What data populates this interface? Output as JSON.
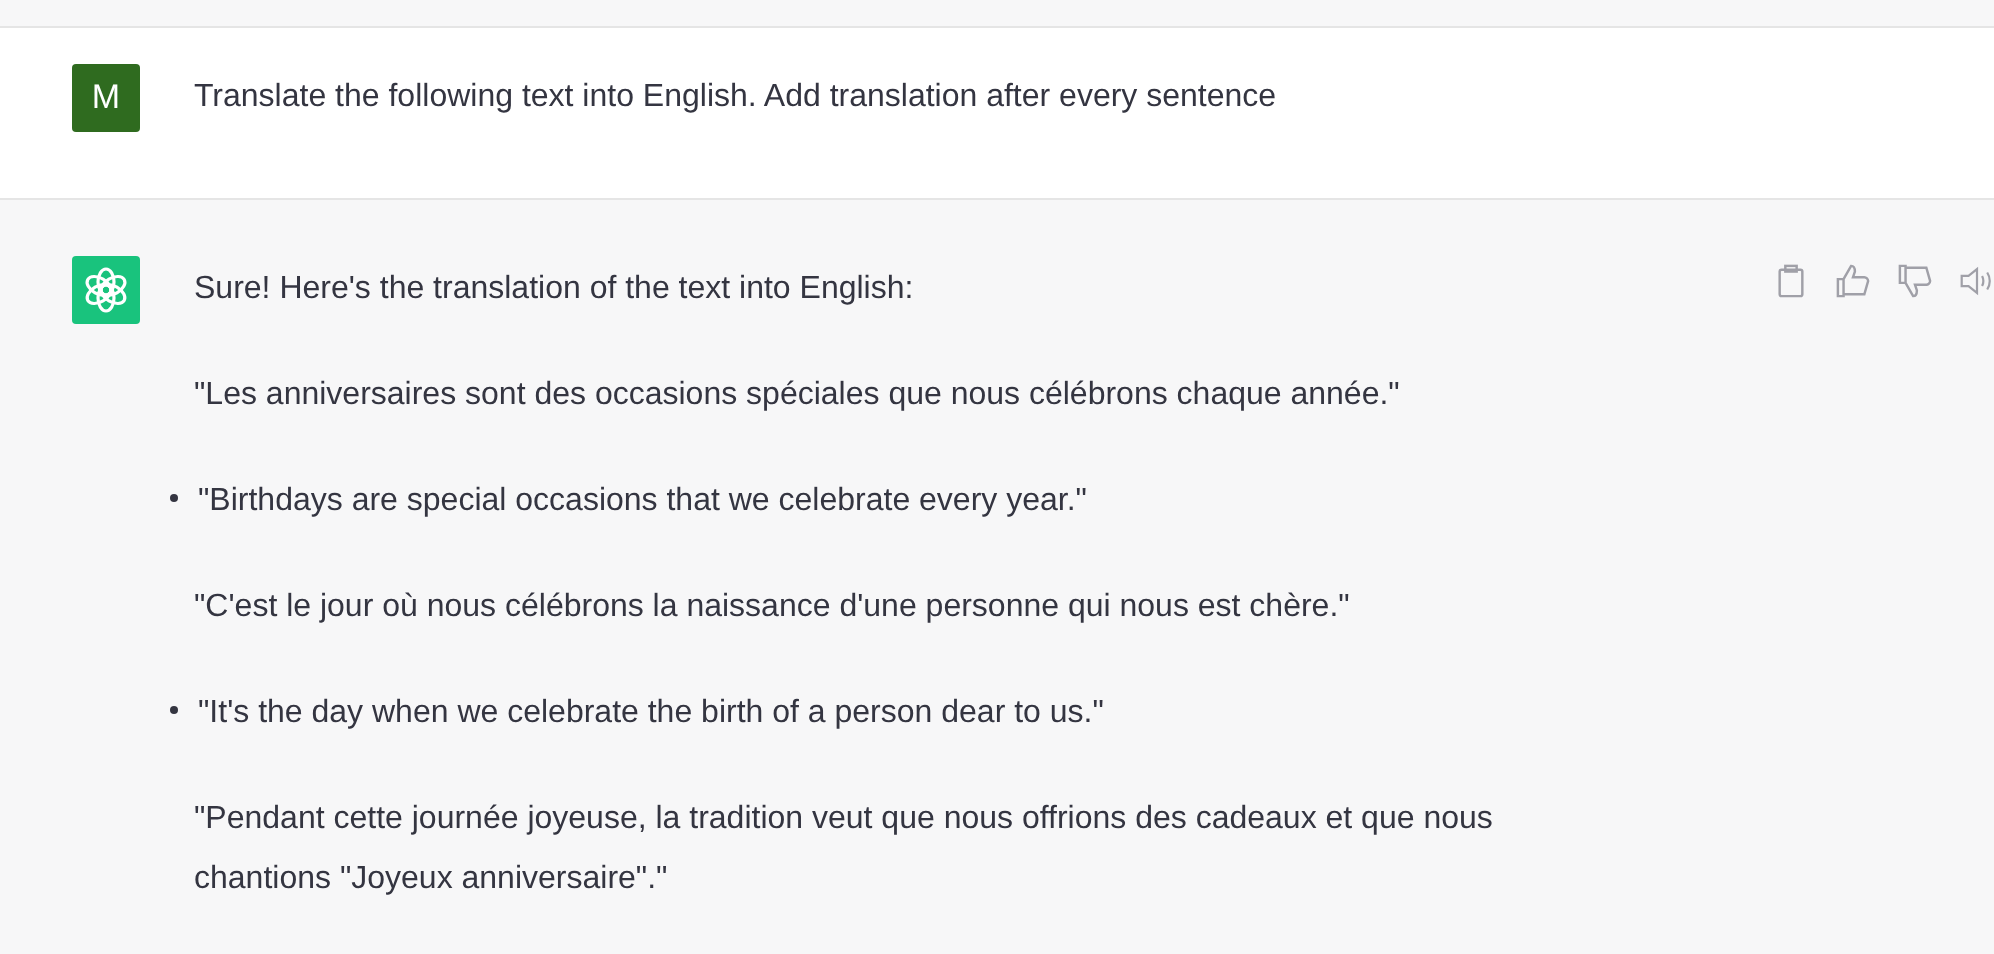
{
  "user_message": {
    "avatar": "M",
    "text": "Translate the following text into English. Add translation after every sentence"
  },
  "assistant_message": {
    "blocks": [
      {
        "kind": "paragraph",
        "text": "Sure! Here's the translation of the text into English:"
      },
      {
        "kind": "paragraph",
        "text": "\"Les anniversaires sont des occasions spéciales que nous célébrons chaque année.\""
      },
      {
        "kind": "bullet",
        "text": "\"Birthdays are special occasions that we celebrate every year.\""
      },
      {
        "kind": "paragraph",
        "text": "\"C'est le jour où nous célébrons la naissance d'une personne qui nous est chère.\""
      },
      {
        "kind": "bullet",
        "text": "\"It's the day when we celebrate the birth of a person dear to us.\""
      },
      {
        "kind": "paragraph",
        "text": "\"Pendant cette journée joyeuse, la tradition veut que nous offrions des cadeaux et que nous chantions \"Joyeux anniversaire\".\""
      }
    ]
  }
}
